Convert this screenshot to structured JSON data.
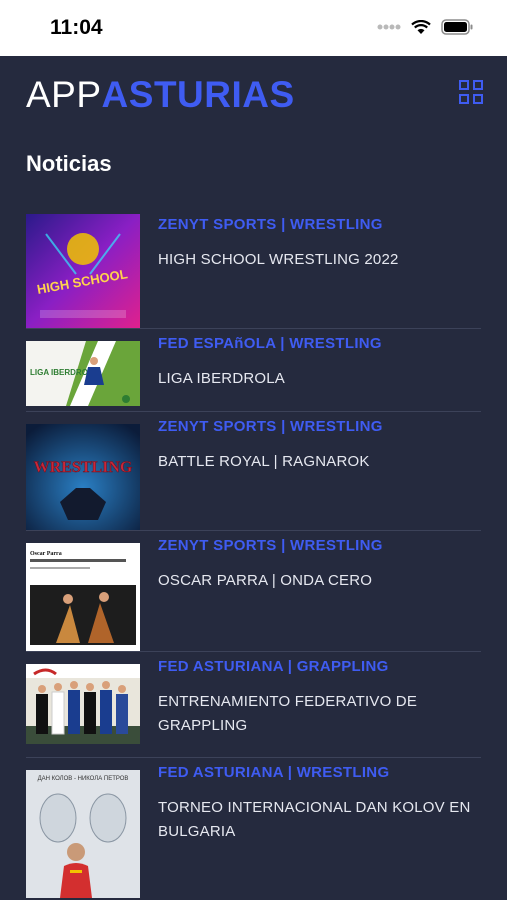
{
  "status_bar": {
    "time": "11:04"
  },
  "header": {
    "logo_prefix": "APP",
    "logo_brand": "ASTURIAS"
  },
  "section": {
    "title": "Noticias"
  },
  "news": [
    {
      "category": "ZENYT SPORTS | WRESTLING",
      "title": "HIGH SCHOOL WRESTLING 2022",
      "thumb_text": "HIGH SCHOOL"
    },
    {
      "category": "FED ESPAñOLA | WRESTLING",
      "title": "LIGA IBERDROLA",
      "thumb_text": "LIGA IBERDROLA"
    },
    {
      "category": "ZENYT SPORTS | WRESTLING",
      "title": "BATTLE ROYAL | RAGNAROK",
      "thumb_text": "WRESTLING"
    },
    {
      "category": "ZENYT SPORTS | WRESTLING",
      "title": "OSCAR PARRA | ONDA CERO",
      "thumb_text": "Oscar Parra"
    },
    {
      "category": "FED ASTURIANA | GRAPPLING",
      "title": "ENTRENAMIENTO FEDERATIVO DE GRAPPLING",
      "thumb_text": ""
    },
    {
      "category": "FED ASTURIANA | WRESTLING",
      "title": "TORNEO INTERNACIONAL DAN KOLOV EN BULGARIA",
      "thumb_text": "ДАН КОЛОВ - НИКОЛА ПЕТРОВ"
    }
  ],
  "colors": {
    "accent": "#3f5cf2",
    "background": "#252a3e",
    "divider": "#3c4259"
  }
}
